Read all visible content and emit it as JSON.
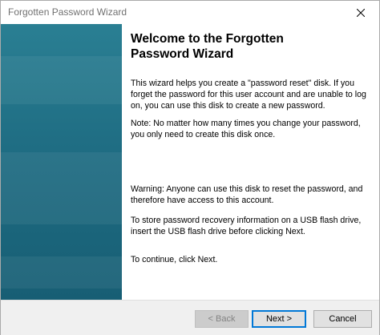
{
  "window": {
    "title": "Forgotten Password Wizard"
  },
  "content": {
    "heading": "Welcome to the Forgotten Password Wizard",
    "paragraphs": [
      "This wizard helps you create a \"password reset\" disk. If you forget the password for this user account and are unable to log on, you can use this disk to create a new password.",
      "Note: No matter how many times you change your password, you only need to create this disk once.",
      "Warning: Anyone can use this disk to reset the password, and therefore have access to this account.",
      "To store password recovery information on a USB flash drive, insert the USB flash drive before clicking Next.",
      "To continue, click Next."
    ]
  },
  "buttons": {
    "back": "< Back",
    "next": "Next >",
    "cancel": "Cancel"
  },
  "icons": {
    "close": "close-icon"
  },
  "colors": {
    "side_panel": "#1f6d83",
    "focus_border": "#0078d7"
  }
}
